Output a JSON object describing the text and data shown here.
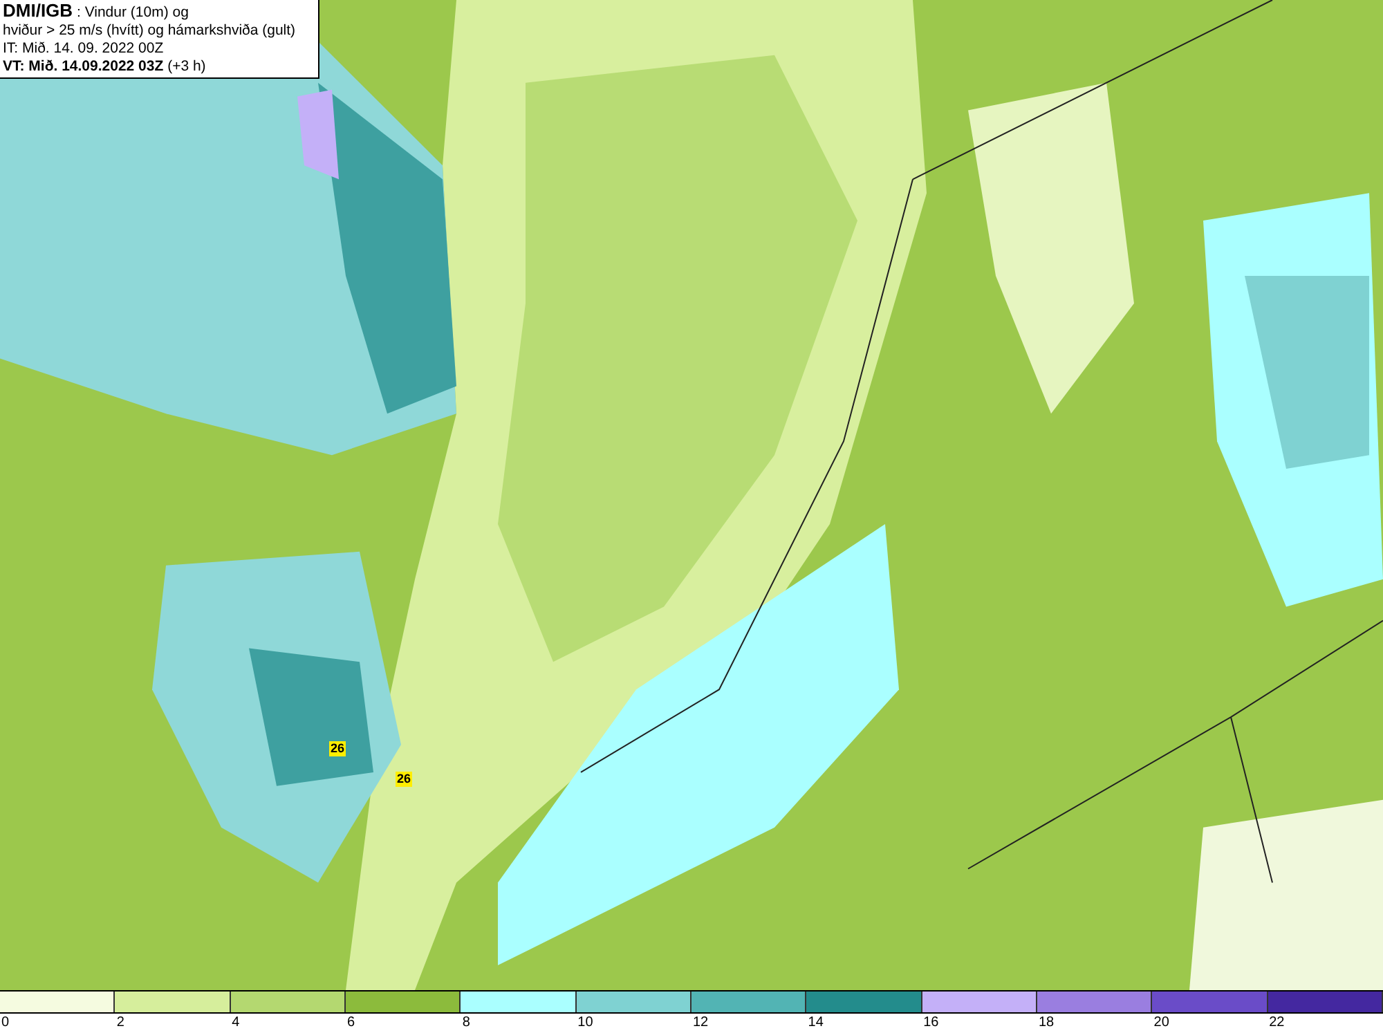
{
  "info_box": {
    "lines": [
      "**DMI/IGB** : Vindur (10m) og",
      "hviður > 25 m/s (hvítt) og hámarkshviða (gult)",
      "IT: Mið. 14. 09. 2022 00Z",
      "**VT: Mið. 14.09.2022 03Z** (+3 h)"
    ]
  },
  "max_gust_labels": [
    {
      "text": "26"
    },
    {
      "text": "26"
    }
  ],
  "legend": {
    "bins": [
      {
        "color": "#f5fbe0"
      },
      {
        "color": "#d6ee9c"
      },
      {
        "color": "#b4d870"
      },
      {
        "color": "#8cbb3c"
      },
      {
        "color": "#aaffff"
      },
      {
        "color": "#7fd2d2"
      },
      {
        "color": "#52b4b4"
      },
      {
        "color": "#238c8c"
      },
      {
        "color": "#c4b0f8"
      },
      {
        "color": "#9a7ee0"
      },
      {
        "color": "#6a4cc8"
      },
      {
        "color": "#4428a0"
      }
    ],
    "ticks": [
      "0",
      "2",
      "4",
      "6",
      "8",
      "10",
      "12",
      "14",
      "16",
      "18",
      "20",
      "22"
    ]
  }
}
